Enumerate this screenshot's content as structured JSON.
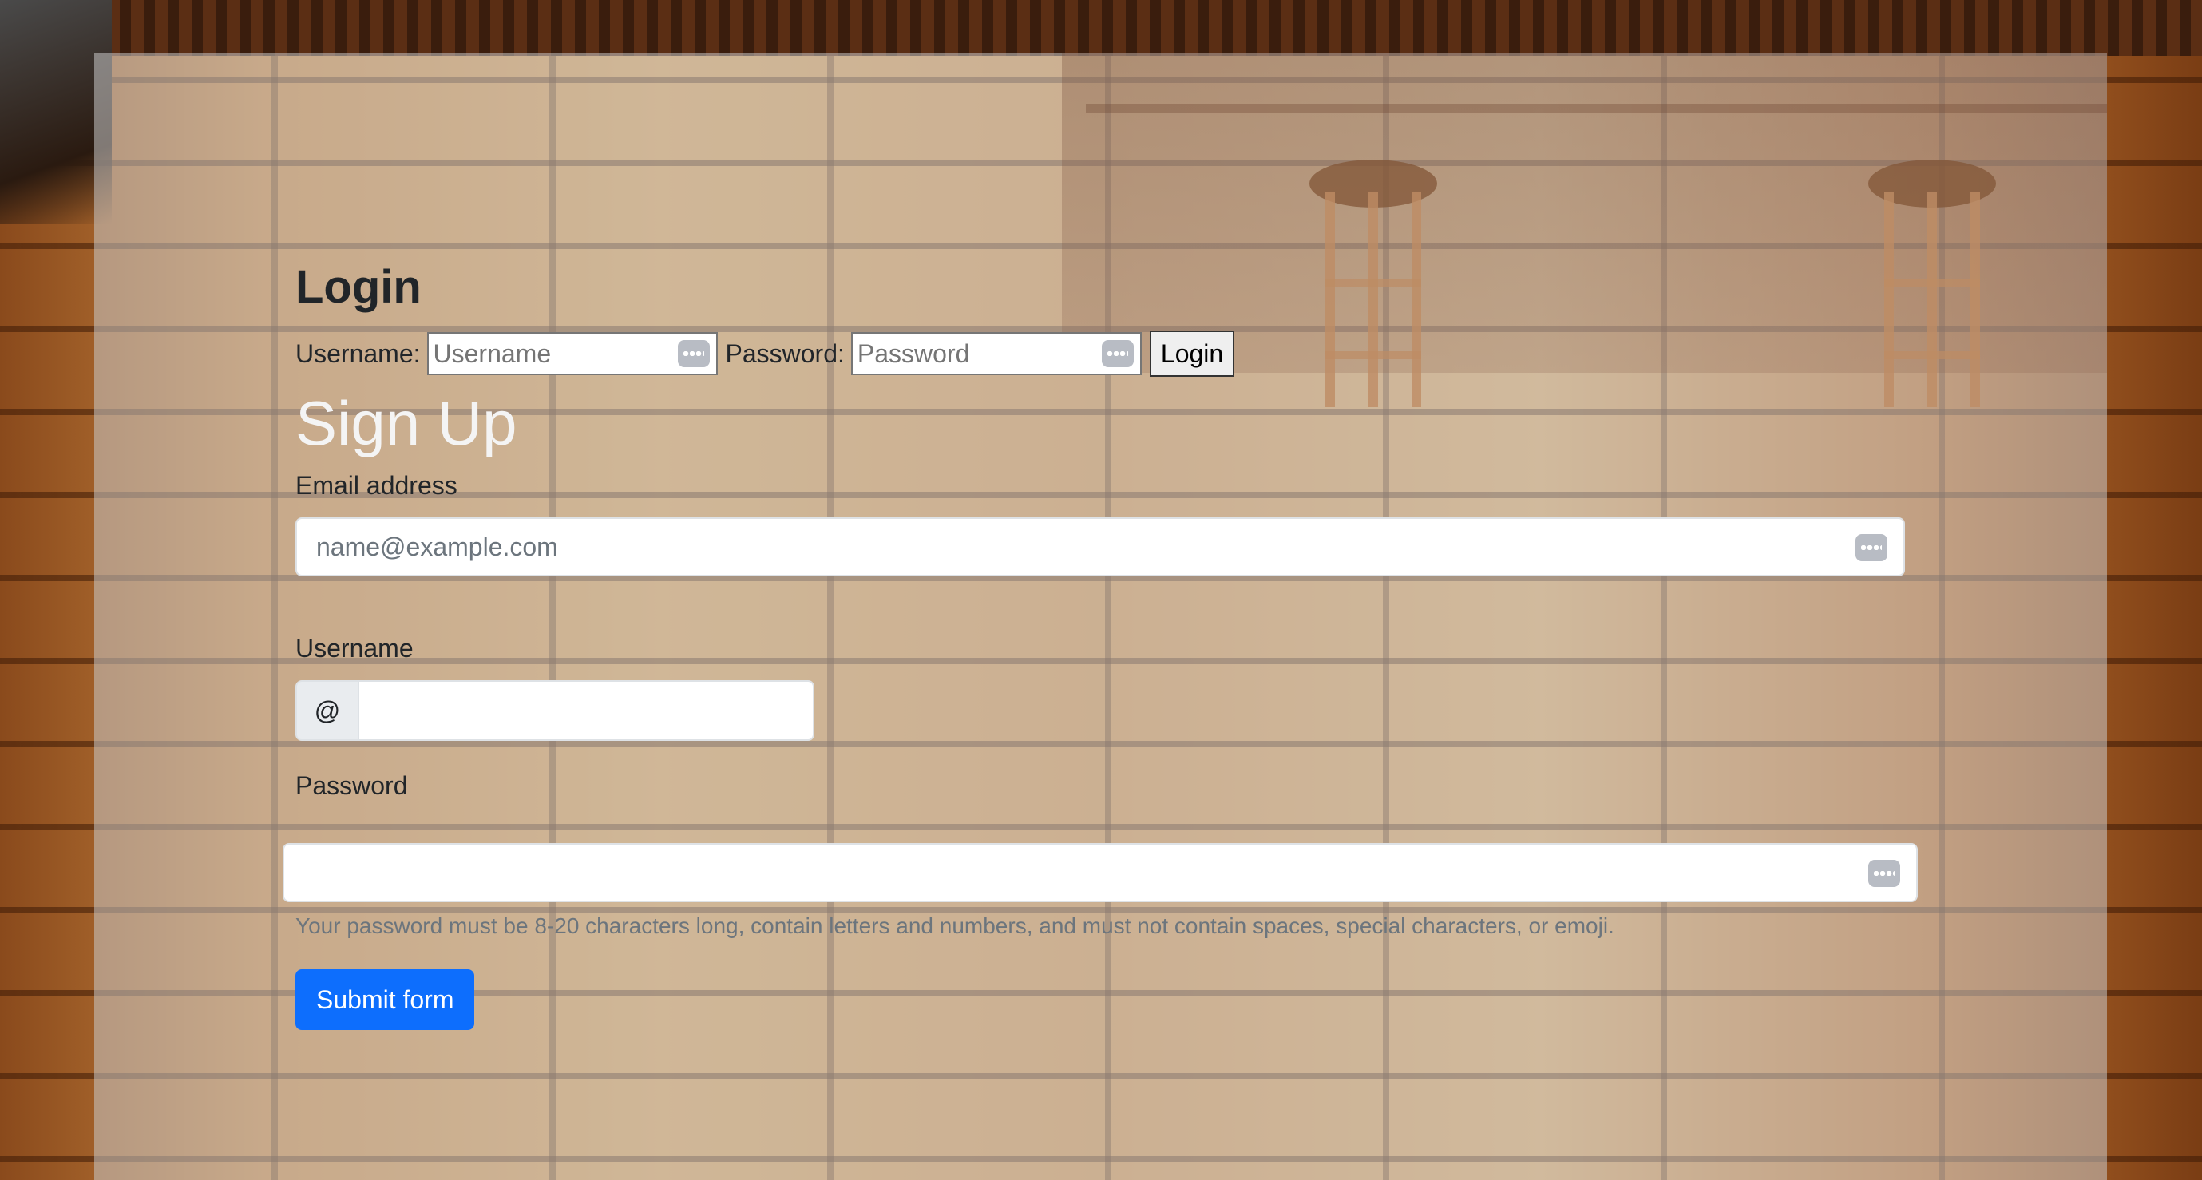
{
  "login": {
    "heading": "Login",
    "username_label": "Username:",
    "username_placeholder": "Username",
    "password_label": "Password:",
    "password_placeholder": "Password",
    "button_label": "Login"
  },
  "signup": {
    "heading": "Sign Up",
    "email_label": "Email address",
    "email_placeholder": "name@example.com",
    "username_label": "Username",
    "username_prefix": "@",
    "username_value": "",
    "password_label": "Password",
    "password_value": "",
    "password_help": "Your password must be 8-20 characters long, contain letters and numbers, and must not contain spaces, special characters, or emoji.",
    "submit_label": "Submit form"
  },
  "icons": {
    "password_manager": "keyboard-dots-icon"
  },
  "colors": {
    "primary_button": "#0d6efd",
    "panel_overlay": "rgba(200,200,200,0.55)",
    "signup_heading": "#f4f4f4",
    "help_text": "#6c757d"
  }
}
